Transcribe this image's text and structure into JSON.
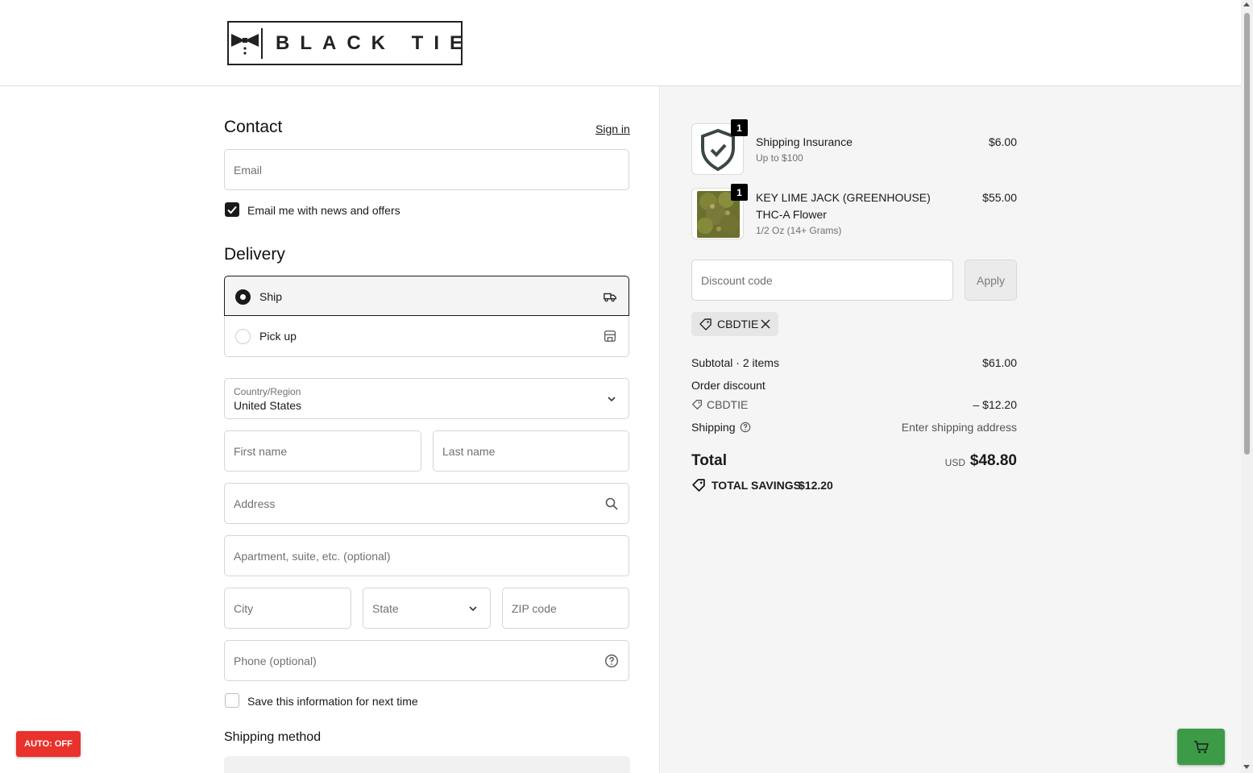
{
  "brand": {
    "logo_text": "BLACK TIE"
  },
  "contact": {
    "heading": "Contact",
    "sign_in": "Sign in",
    "email_placeholder": "Email",
    "news_checkbox_label": "Email me with news and offers",
    "news_checked": true
  },
  "delivery": {
    "heading": "Delivery",
    "options": [
      {
        "label": "Ship",
        "selected": true,
        "icon": "truck-icon"
      },
      {
        "label": "Pick up",
        "selected": false,
        "icon": "store-icon"
      }
    ],
    "country_label": "Country/Region",
    "country_value": "United States",
    "first_name": "First name",
    "last_name": "Last name",
    "address": "Address",
    "apartment": "Apartment, suite, etc. (optional)",
    "city": "City",
    "state": "State",
    "zip": "ZIP code",
    "phone": "Phone (optional)",
    "save_info_label": "Save this information for next time",
    "save_info_checked": false
  },
  "shipping_method": {
    "heading": "Shipping method"
  },
  "auto_button": "AUTO: OFF",
  "summary": {
    "items": [
      {
        "name": "Shipping Insurance",
        "variant": "Up to $100",
        "price": "$6.00",
        "quantity": "1"
      },
      {
        "name": "KEY LIME JACK (GREENHOUSE) THC-A Flower",
        "variant": "1/2 Oz (14+ Grams)",
        "price": "$55.00",
        "quantity": "1"
      }
    ],
    "discount_placeholder": "Discount code",
    "apply_label": "Apply",
    "applied_code": "CBDTIE",
    "subtotal_label": "Subtotal · 2 items",
    "subtotal_value": "$61.00",
    "order_discount_label": "Order discount",
    "discount_code": "CBDTIE",
    "discount_value": "– $12.20",
    "shipping_label": "Shipping",
    "shipping_value": "Enter shipping address",
    "total_label": "Total",
    "total_currency": "USD",
    "total_value": "$48.80",
    "savings_label": "TOTAL SAVINGS",
    "savings_value": "$12.20"
  },
  "colors": {
    "accent_dark": "#1a1a1a",
    "auto_red": "#e8322b",
    "cart_green": "#3d9b47",
    "summary_bg": "#f5f5f5"
  }
}
